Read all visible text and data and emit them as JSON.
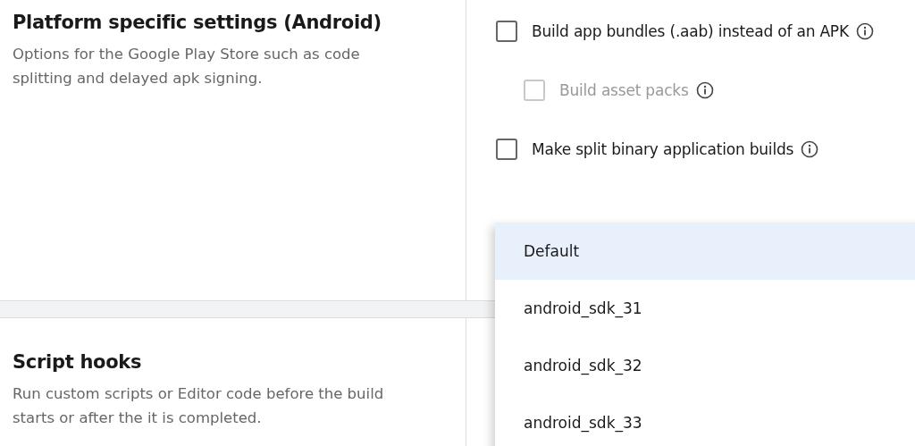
{
  "sections": [
    {
      "title": "Platform specific settings (Android)",
      "description": "Options for the Google Play Store such as code splitting and delayed apk signing.",
      "options": [
        {
          "label": "Build app bundles (.aab) instead of an APK",
          "checked": false,
          "disabled": false,
          "children": [
            {
              "label": "Build asset packs",
              "checked": false,
              "disabled": true
            }
          ]
        },
        {
          "label": "Make split binary application builds",
          "checked": false,
          "disabled": false
        }
      ]
    },
    {
      "title": "Script hooks",
      "description": "Run custom scripts or Editor code before the build starts or after the it is completed."
    }
  ],
  "dropdown": {
    "items": [
      {
        "label": "Default",
        "selected": true
      },
      {
        "label": "android_sdk_31",
        "selected": false
      },
      {
        "label": "android_sdk_32",
        "selected": false
      },
      {
        "label": "android_sdk_33",
        "selected": false
      }
    ]
  }
}
